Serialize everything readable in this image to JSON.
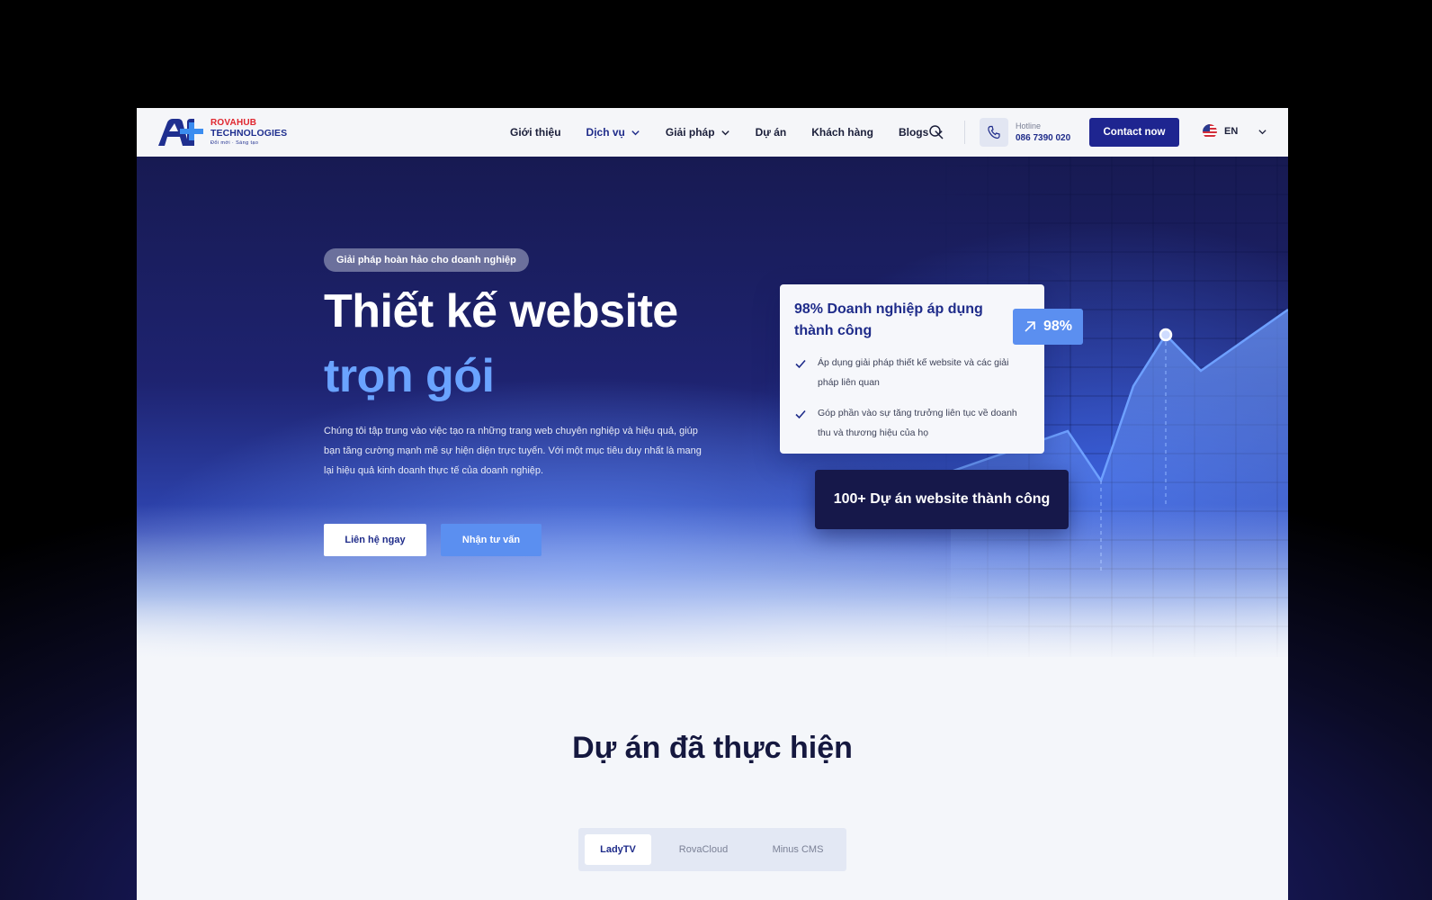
{
  "header": {
    "logo": {
      "line1": "ROVAHUB",
      "line2": "TECHNOLOGIES",
      "tagline": "Đổi mới · Sáng tạo"
    },
    "nav": [
      {
        "label": "Giới thiệu",
        "dropdown": false
      },
      {
        "label": "Dịch vụ",
        "dropdown": true,
        "active": true
      },
      {
        "label": "Giải pháp",
        "dropdown": true
      },
      {
        "label": "Dự án",
        "dropdown": false
      },
      {
        "label": "Khách hàng",
        "dropdown": false
      },
      {
        "label": "Blogs",
        "dropdown": true
      }
    ],
    "search_icon": "search-icon",
    "hotline": {
      "label": "Hotline",
      "number": "086 7390 020",
      "icon": "phone-icon"
    },
    "contact_button": "Contact now",
    "language": {
      "code": "EN",
      "flag": "us-flag-icon"
    }
  },
  "hero": {
    "pill": "Giải pháp hoàn hảo cho doanh nghiệp",
    "title_line1": "Thiết kế website",
    "title_line2": "trọn gói",
    "description": "Chúng tôi tập trung vào việc tạo ra những trang web chuyên nghiệp và hiệu quả, giúp bạn tăng cường mạnh mẽ sự hiện diện trực tuyến. Với một mục tiêu duy nhất là mang lại hiệu quả kinh doanh thực tế của doanh nghiệp.",
    "primary_button": "Liên hệ ngay",
    "secondary_button": "Nhận tư vấn",
    "stat_card": {
      "title": "98% Doanh nghiệp áp dụng thành công",
      "items": [
        "Áp dụng giải pháp thiết kế website và các giải pháp liên quan",
        "Góp phần vào sự tăng trưởng liên tục về doanh thu và thương hiệu của họ"
      ]
    },
    "badge": {
      "value": "98%",
      "icon": "arrow-up-right-icon"
    },
    "projects_card": "100+ Dự án website thành công"
  },
  "projects": {
    "title": "Dự án đã thực hiện",
    "tabs": [
      "LadyTV",
      "RovaCloud",
      "Minus CMS"
    ],
    "active_tab": 0
  },
  "colors": {
    "brand_dark": "#1e2590",
    "accent_blue": "#5b8ff0",
    "title_light_blue": "#6aa3ff",
    "logo_red": "#e0262e"
  }
}
